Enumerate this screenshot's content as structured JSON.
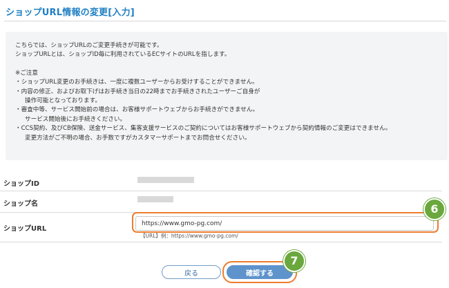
{
  "page_title": "ショップURL情報の変更[入力]",
  "notice": {
    "intro": [
      "こちらでは、ショップURLのご変更手続きが可能です。",
      "ショップURLとは、ショップID毎に利用されているECサイトのURLを指します。"
    ],
    "caution_heading": "※ご注意",
    "bullets": [
      "・ショップURL変更のお手続きは、一度に複数ユーザーからお受けすることができません。",
      "・内容の修正、およびお取下げはお手続き当日の22時までお手続きされたユーザーご自身が",
      "操作可能となっております。",
      "・審査中等、サービス開始前の場合は、お客様サポートウェブからお手続きができません。",
      "サービス開始後にお手続きください。",
      "・CCS契約、及びCB保険、送金サービス、集客支援サービスのご契約についてはお客様サポートウェブから契約情報のご変更はできません。",
      "変更方法がご不明の場合、お手数ですがカスタマーサポートまでお問合せください。"
    ]
  },
  "form": {
    "shop_id_label": "ショップID",
    "shop_name_label": "ショップ名",
    "shop_url_label": "ショップURL",
    "shop_url_value": "https://www.gmo-pg.com/",
    "shop_url_hint": "【URL】例：https://www.gmo-pg.com/"
  },
  "buttons": {
    "back_label": "戻る",
    "confirm_label": "確認する"
  },
  "badges": {
    "url_step": "6",
    "confirm_step": "7"
  },
  "colors": {
    "title": "#1f7fc4",
    "highlight": "#ed7c2d",
    "badge": "#6aa83d",
    "confirm_button": "#5f93cc"
  }
}
